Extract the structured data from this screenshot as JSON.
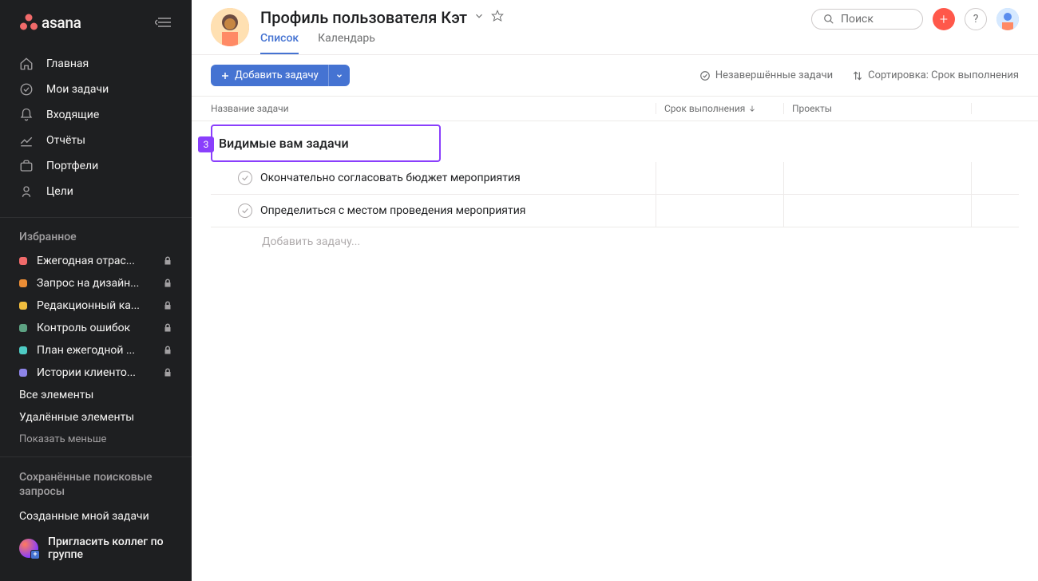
{
  "brand": "asana",
  "sidebar": {
    "nav": [
      {
        "icon": "home",
        "label": "Главная"
      },
      {
        "icon": "check-circle",
        "label": "Мои задачи"
      },
      {
        "icon": "bell",
        "label": "Входящие"
      },
      {
        "icon": "chart",
        "label": "Отчёты"
      },
      {
        "icon": "folder",
        "label": "Портфели"
      },
      {
        "icon": "target",
        "label": "Цели"
      }
    ],
    "favorites_header": "Избранное",
    "projects": [
      {
        "color": "#f06a6a",
        "name": "Ежегодная отрас..."
      },
      {
        "color": "#ec8d35",
        "name": "Запрос на дизайн..."
      },
      {
        "color": "#f1bd3e",
        "name": "Редакционный ка..."
      },
      {
        "color": "#5da283",
        "name": "Контроль ошибок"
      },
      {
        "color": "#4ecbc4",
        "name": "План ежегодной ..."
      },
      {
        "color": "#8d84e8",
        "name": "Истории клиенто..."
      }
    ],
    "all_items": "Все элементы",
    "deleted_items": "Удалённые элементы",
    "show_less": "Показать меньше",
    "saved_searches_header": "Сохранённые поисковые запросы",
    "created_by_me": "Созданные мной задачи",
    "invite": "Пригласить коллег по группе"
  },
  "header": {
    "title": "Профиль пользователя Кэт",
    "tabs": {
      "list": "Список",
      "calendar": "Календарь"
    },
    "search_placeholder": "Поиск"
  },
  "toolbar": {
    "add_task": "Добавить задачу",
    "filter_incomplete": "Незавершённые задачи",
    "sort_label": "Сортировка: Срок выполнения"
  },
  "columns": {
    "name": "Название задачи",
    "date": "Срок выполнения",
    "projects": "Проекты"
  },
  "section_badge": "3",
  "section_title": "Видимые вам задачи",
  "tasks": [
    {
      "name": "Окончательно согласовать бюджет мероприятия"
    },
    {
      "name": "Определиться с местом проведения мероприятия"
    }
  ],
  "add_task_placeholder": "Добавить задачу..."
}
